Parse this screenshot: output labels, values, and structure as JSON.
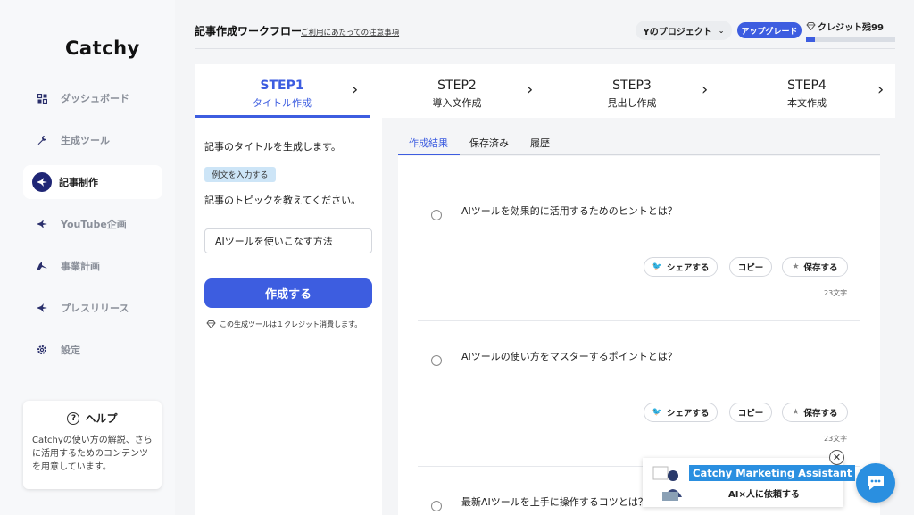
{
  "app": {
    "logo": "Catchy"
  },
  "sidebar": {
    "items": [
      {
        "label": "ダッシュボード",
        "icon": "dashboard-icon",
        "active": false
      },
      {
        "label": "生成ツール",
        "icon": "wrench-icon",
        "active": false
      },
      {
        "label": "記事制作",
        "icon": "bird-icon",
        "active": true
      },
      {
        "label": "YouTube企画",
        "icon": "bird-icon",
        "active": false
      },
      {
        "label": "事業計画",
        "icon": "bird-icon",
        "active": false
      },
      {
        "label": "プレスリリース",
        "icon": "bird-icon",
        "active": false
      },
      {
        "label": "設定",
        "icon": "gear-icon",
        "active": false
      }
    ],
    "help": {
      "title": "ヘルプ",
      "text": "Catchyの使い方の解説、さらに活用するためのコンテンツを用意しています。"
    }
  },
  "header": {
    "title": "記事作成ワークフロー",
    "notice_link": "ご利用にあたっての注意事項",
    "project": "Yのプロジェクト",
    "upgrade": "アップグレード",
    "credit": "クレジット残99",
    "credit_fraction": 0.1
  },
  "steps": [
    {
      "num": "STEP1",
      "name": "タイトル作成",
      "active": true
    },
    {
      "num": "STEP2",
      "name": "導入文作成",
      "active": false
    },
    {
      "num": "STEP3",
      "name": "見出し作成",
      "active": false
    },
    {
      "num": "STEP4",
      "name": "本文作成",
      "active": false
    }
  ],
  "form": {
    "description": "記事のタイトルを生成します。",
    "example_tag": "例文を入力する",
    "topic_label": "記事のトピックを教えてください。",
    "topic_value": "AIツールを使いこなす方法",
    "submit": "作成する",
    "cost_note": "この生成ツールは１クレジット消費します。"
  },
  "results": {
    "tabs": [
      "作成結果",
      "保存済み",
      "履歴"
    ],
    "active_tab": 0,
    "share_label": "シェアする",
    "copy_label": "コピー",
    "save_label": "保存する",
    "items": [
      {
        "title": "AIツールを効果的に活用するためのヒントとは？",
        "count": "23文字"
      },
      {
        "title": "AIツールの使い方をマスターするポイントとは？",
        "count": "23文字"
      },
      {
        "title": "最新AIツールを上手に操作するコツとは？",
        "count": ""
      }
    ]
  },
  "assistant": {
    "title": "Catchy Marketing Assistant",
    "subtitle": "AI×人に依頼する",
    "close": "✕"
  },
  "colors": {
    "accent": "#3d5de0",
    "navy": "#1f2675",
    "assistant_blue": "#2a8fe0"
  }
}
